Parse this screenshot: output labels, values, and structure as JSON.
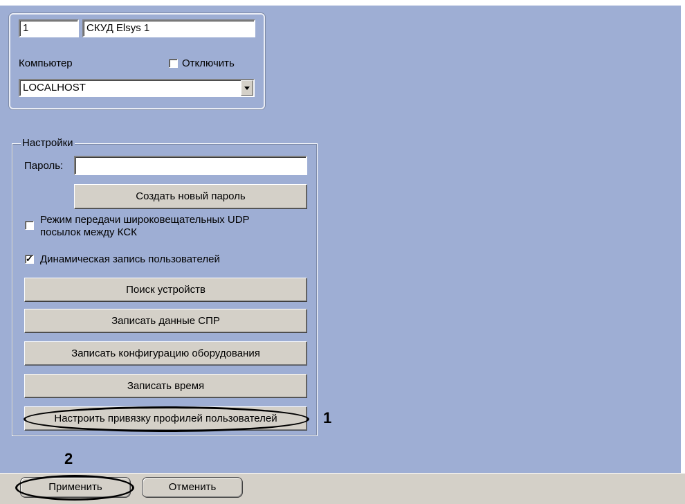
{
  "object": {
    "id": "1",
    "name": "СКУД Elsys 1",
    "computer_label": "Компьютер",
    "disable_label": "Отключить",
    "disable_checked": false,
    "computer_value": "LOCALHOST"
  },
  "settings": {
    "group_label": "Настройки",
    "password_label": "Пароль:",
    "password_value": "",
    "create_password_button": "Создать новый пароль",
    "udp_broadcast_label_line1": "Режим передачи широковещательных UDP",
    "udp_broadcast_label_line2": "посылок между КСК",
    "udp_broadcast_checked": false,
    "dynamic_users_label": "Динамическая запись пользователей",
    "dynamic_users_checked": true,
    "search_devices_button": "Поиск устройств",
    "write_spr_button": "Записать данные СПР",
    "write_hw_config_button": "Записать конфигурацию оборудования",
    "write_time_button": "Записать время",
    "profile_binding_button": "Настроить привязку профилей пользователей"
  },
  "footer": {
    "apply_button": "Применить",
    "cancel_button": "Отменить"
  },
  "annotations": {
    "callout_1": "1",
    "callout_2": "2"
  },
  "colors": {
    "background": "#9eaed4",
    "button_face": "#d4d0c8"
  }
}
